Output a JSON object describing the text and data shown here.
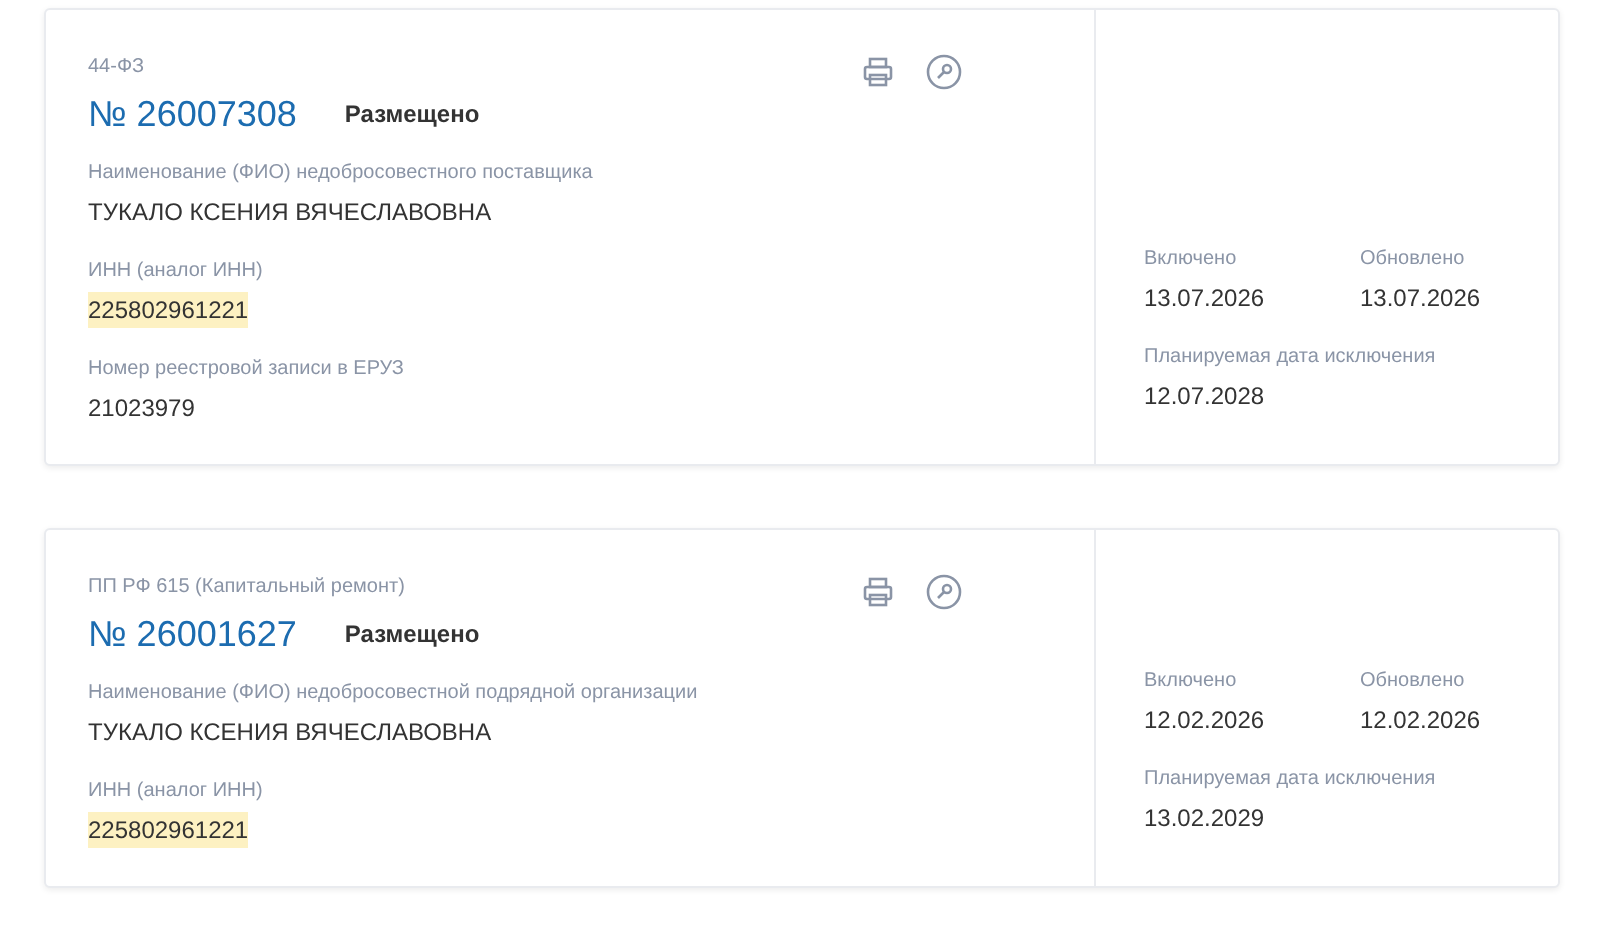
{
  "records": [
    {
      "law": "44-ФЗ",
      "number": "№ 26007308",
      "status": "Размещено",
      "fields": [
        {
          "label": "Наименование (ФИО) недобросовестного поставщика",
          "value": "ТУКАЛО КСЕНИЯ ВЯЧЕСЛАВОВНА",
          "highlighted": false
        },
        {
          "label": "ИНН (аналог ИНН)",
          "value": "225802961221",
          "highlighted": true
        },
        {
          "label": "Номер реестровой записи в ЕРУЗ",
          "value": "21023979",
          "highlighted": false
        }
      ],
      "dates": [
        {
          "label": "Включено",
          "value": "13.07.2026"
        },
        {
          "label": "Обновлено",
          "value": "13.07.2026"
        },
        {
          "label": "Планируемая дата исключения",
          "value": "12.07.2028"
        }
      ]
    },
    {
      "law": "ПП РФ 615 (Капитальный ремонт)",
      "number": "№ 26001627",
      "status": "Размещено",
      "fields": [
        {
          "label": "Наименование (ФИО) недобросовестной подрядной организации",
          "value": "ТУКАЛО КСЕНИЯ ВЯЧЕСЛАВОВНА",
          "highlighted": false
        },
        {
          "label": "ИНН (аналог ИНН)",
          "value": "225802961221",
          "highlighted": true
        }
      ],
      "dates": [
        {
          "label": "Включено",
          "value": "12.02.2026"
        },
        {
          "label": "Обновлено",
          "value": "12.02.2026"
        },
        {
          "label": "Планируемая дата исключения",
          "value": "13.02.2029"
        }
      ]
    }
  ]
}
